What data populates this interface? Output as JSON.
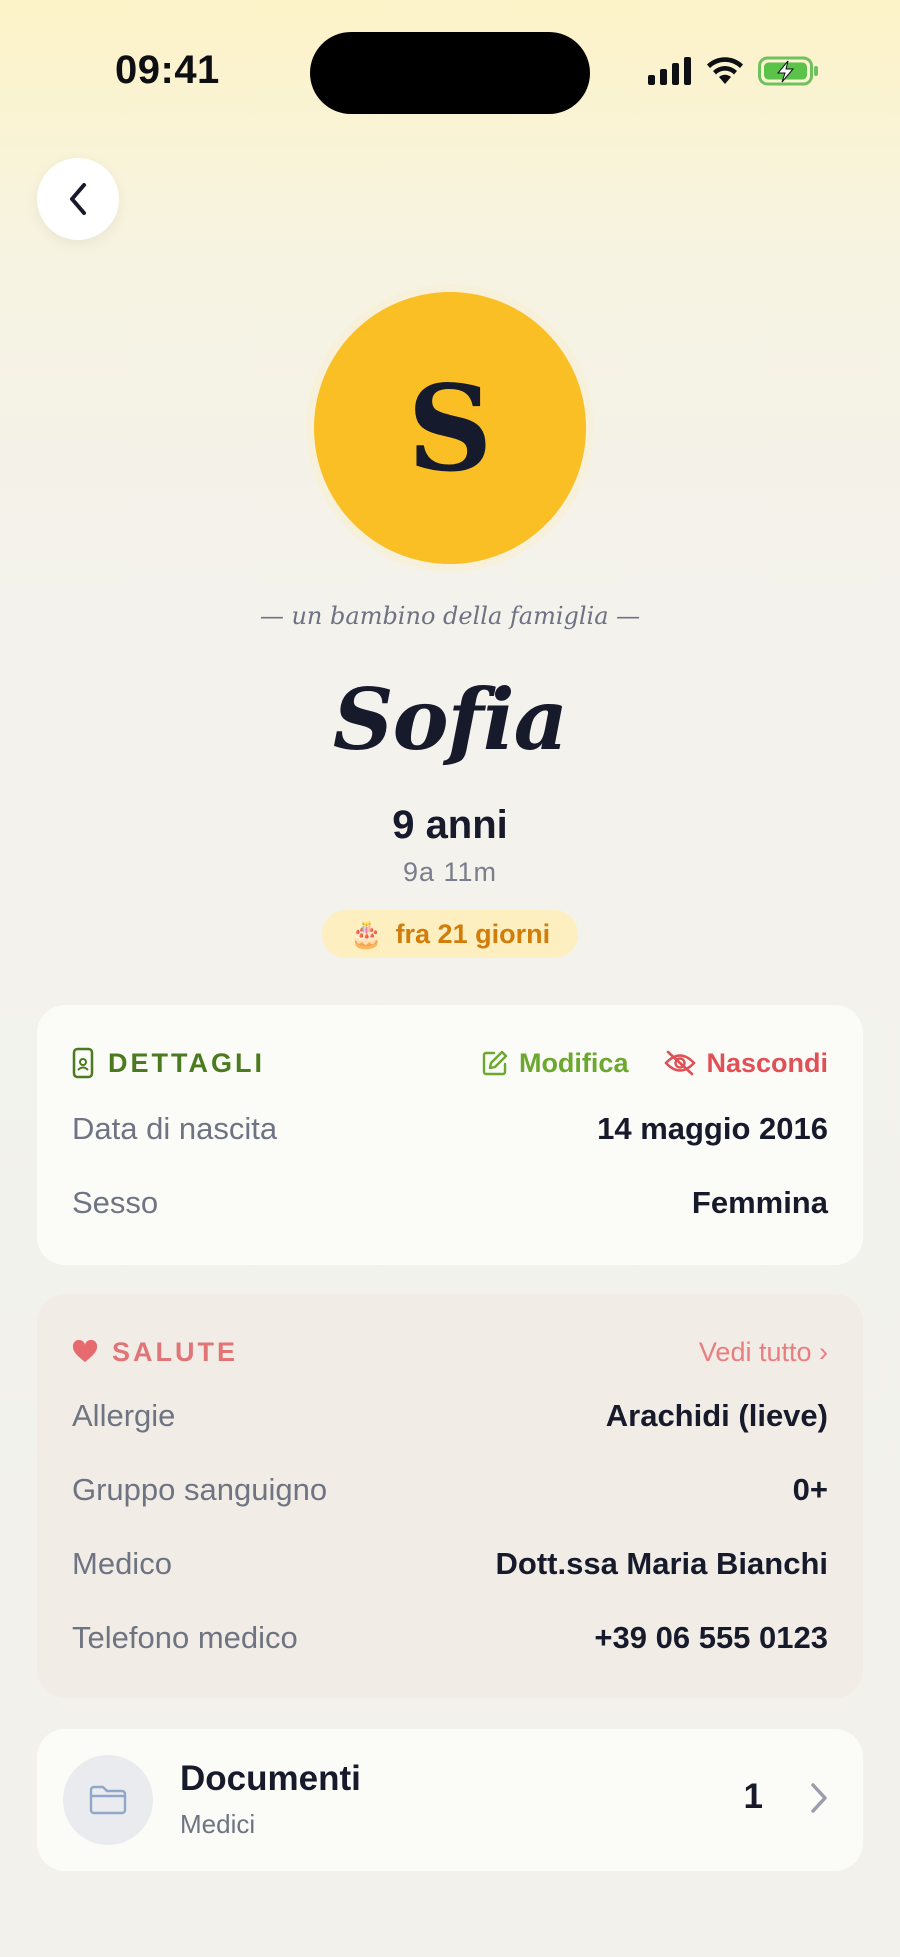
{
  "status_bar": {
    "time": "09:41"
  },
  "header": {
    "back_icon": "chevron-left-icon"
  },
  "profile": {
    "avatar_letter": "S",
    "avatar_color": "#fbbf26",
    "subtitle": "— un bambino della famiglia —",
    "name": "Sofia",
    "age": "9 anni",
    "age_detail": "9a 11m",
    "birthday_icon": "🎂",
    "birthday_text": "fra 21 giorni"
  },
  "details": {
    "title": "DETTAGLI",
    "edit_label": "Modifica",
    "hide_label": "Nascondi",
    "rows": [
      {
        "label": "Data di nascita",
        "value": "14 maggio 2016"
      },
      {
        "label": "Sesso",
        "value": "Femmina"
      }
    ]
  },
  "health": {
    "title": "SALUTE",
    "see_all_label": "Vedi tutto ›",
    "rows": [
      {
        "label": "Allergie",
        "value": "Arachidi (lieve)"
      },
      {
        "label": "Gruppo sanguigno",
        "value": "0+"
      },
      {
        "label": "Medico",
        "value": "Dott.ssa Maria Bianchi"
      },
      {
        "label": "Telefono medico",
        "value": "+39 06 555 0123"
      }
    ]
  },
  "documents": {
    "title": "Documenti",
    "subtitle": "Medici",
    "count": "1"
  },
  "colors": {
    "accent_green": "#6aa82e",
    "accent_red": "#e05055",
    "birthday_orange": "#d27c0a"
  }
}
